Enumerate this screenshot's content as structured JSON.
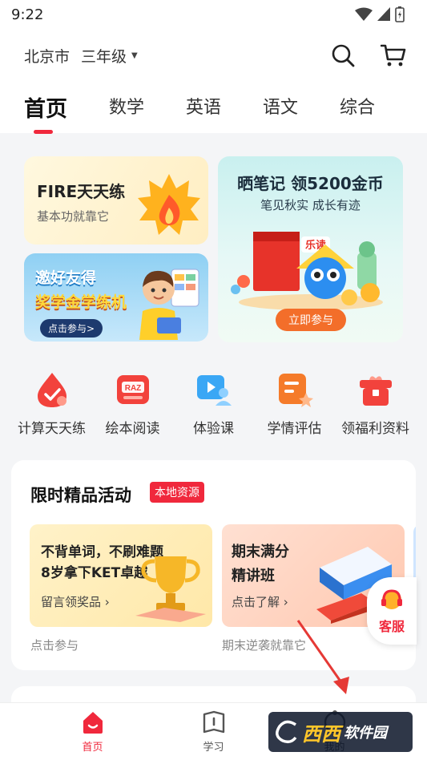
{
  "status": {
    "time": "9:22"
  },
  "header": {
    "location": "北京市",
    "grade": "三年级"
  },
  "tabs": [
    {
      "label": "首页"
    },
    {
      "label": "数学"
    },
    {
      "label": "英语"
    },
    {
      "label": "语文"
    },
    {
      "label": "综合"
    }
  ],
  "banners": {
    "fire": {
      "title": "FIRE天天练",
      "subtitle": "基本功就靠它"
    },
    "invite": {
      "line1": "邀好友得",
      "line2": "奖学金学练机",
      "button": "点击参与>"
    },
    "note": {
      "title": "晒笔记  领5200金币",
      "subtitle": "笔见秋实  成长有迹",
      "button": "立即参与",
      "art_text": "乐读"
    }
  },
  "quick_links": [
    {
      "label": "计算天天练",
      "icon": "calc-drop-icon",
      "color": "#f2423c"
    },
    {
      "label": "绘本阅读",
      "icon": "raz-book-icon",
      "color": "#f2423c",
      "icon_text": "RAZ"
    },
    {
      "label": "体验课",
      "icon": "video-lesson-icon",
      "color": "#3aa7f5"
    },
    {
      "label": "学情评估",
      "icon": "assessment-icon",
      "color": "#f57b2a"
    },
    {
      "label": "领福利资料",
      "icon": "gift-box-icon",
      "color": "#f2423c"
    }
  ],
  "activity": {
    "title": "限时精品活动",
    "badge": "本地资源",
    "cards": [
      {
        "line1": "不背单词，不刷难题",
        "line2": "8岁拿下KET卓越",
        "cta": "留言领奖品",
        "footer": "点击参与"
      },
      {
        "line1": "期末满分",
        "line2": "精讲班",
        "cta": "点击了解",
        "footer": "期末逆袭就靠它"
      }
    ]
  },
  "service": {
    "label": "客服"
  },
  "bottom_nav": [
    {
      "label": "首页"
    },
    {
      "label": "学习"
    },
    {
      "label": "我的"
    }
  ],
  "watermark": {
    "big": "西西",
    "text": "软件园"
  },
  "colors": {
    "accent": "#f0283c"
  }
}
